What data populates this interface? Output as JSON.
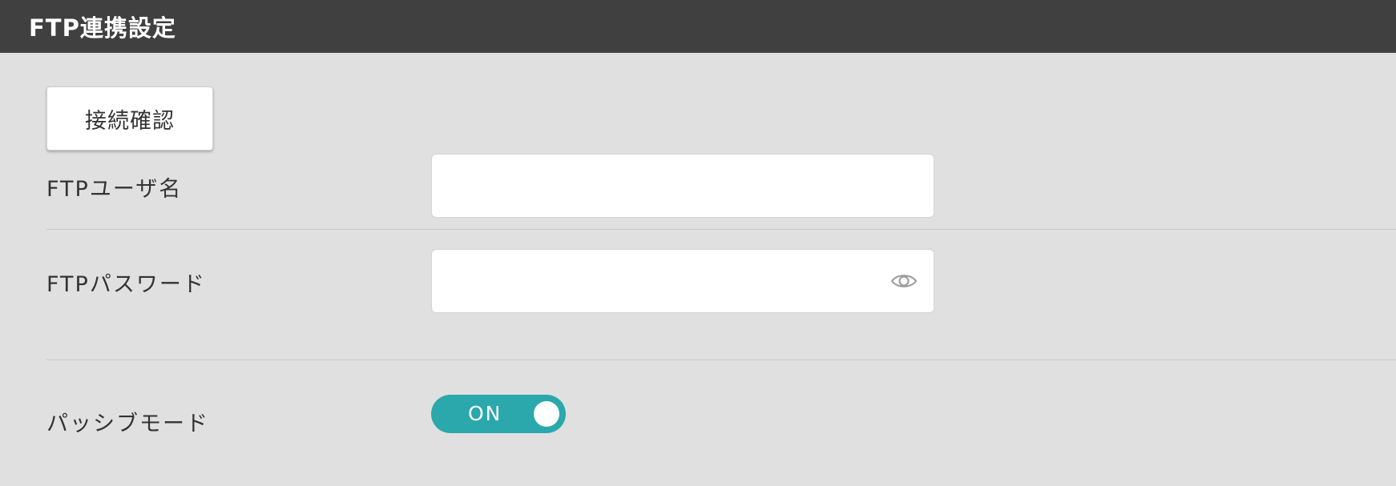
{
  "header": {
    "title": "FTP連携設定"
  },
  "actions": {
    "connection_check_label": "接続確認"
  },
  "form": {
    "username": {
      "label": "FTPユーザ名",
      "value": ""
    },
    "password": {
      "label": "FTPパスワード",
      "value": "",
      "icon": "eye-icon"
    },
    "passive_mode": {
      "label": "パッシブモード",
      "state_label": "ON",
      "checked": true
    }
  },
  "colors": {
    "header_bg": "#404040",
    "page_bg": "#e0e0e0",
    "toggle_on": "#2aa8ab",
    "text": "#333333"
  }
}
